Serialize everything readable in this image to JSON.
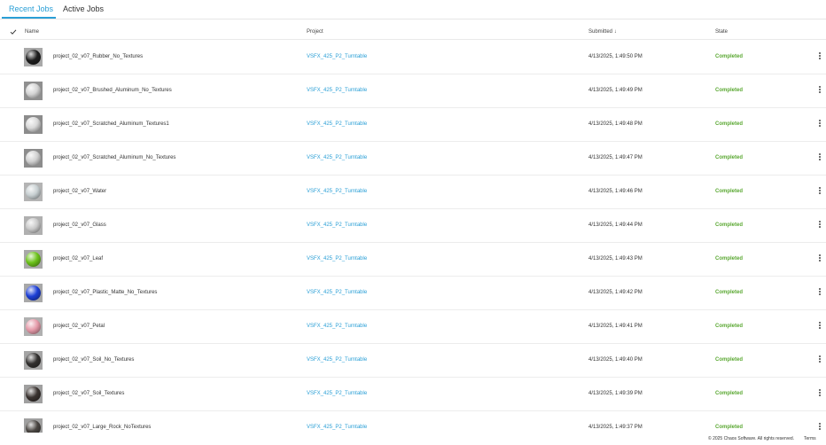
{
  "tabs": {
    "recent": "Recent Jobs",
    "active": "Active Jobs"
  },
  "columns": {
    "name": "Name",
    "project": "Project",
    "submitted": "Submitted",
    "sort_icon": "↓",
    "state": "State"
  },
  "rows": [
    {
      "name": "project_02_v07_Rubber_No_Textures",
      "project": "VSFX_425_P2_Turntable",
      "submitted": "4/13/2025, 1:49:50 PM",
      "state": "Completed",
      "thumb_color": "#1e1e1e",
      "thumb_bg": "#a9a9a9"
    },
    {
      "name": "project_02_v07_Brushed_Aluminum_No_Textures",
      "project": "VSFX_425_P2_Turntable",
      "submitted": "4/13/2025, 1:49:49 PM",
      "state": "Completed",
      "thumb_color": "#d4d4d4",
      "thumb_bg": "#8f8f8f"
    },
    {
      "name": "project_02_v07_Scratched_Aluminum_Textures1",
      "project": "VSFX_425_P2_Turntable",
      "submitted": "4/13/2025, 1:49:48 PM",
      "state": "Completed",
      "thumb_color": "#d8d8d8",
      "thumb_bg": "#8c8c8c"
    },
    {
      "name": "project_02_v07_Scratched_Aluminum_No_Textures",
      "project": "VSFX_425_P2_Turntable",
      "submitted": "4/13/2025, 1:49:47 PM",
      "state": "Completed",
      "thumb_color": "#d0d0d0",
      "thumb_bg": "#8c8c8c"
    },
    {
      "name": "project_02_v07_Water",
      "project": "VSFX_425_P2_Turntable",
      "submitted": "4/13/2025, 1:49:46 PM",
      "state": "Completed",
      "thumb_color": "#c7cfd1",
      "thumb_bg": "#b4b4b4"
    },
    {
      "name": "project_02_v07_Glass",
      "project": "VSFX_425_P2_Turntable",
      "submitted": "4/13/2025, 1:49:44 PM",
      "state": "Completed",
      "thumb_color": "#c9c9c9",
      "thumb_bg": "#b0b0b0"
    },
    {
      "name": "project_02_v07_Leaf",
      "project": "VSFX_425_P2_Turntable",
      "submitted": "4/13/2025, 1:49:43 PM",
      "state": "Completed",
      "thumb_color": "#6cc21b",
      "thumb_bg": "#a8a8a8"
    },
    {
      "name": "project_02_v07_Plastic_Matte_No_Textures",
      "project": "VSFX_425_P2_Turntable",
      "submitted": "4/13/2025, 1:49:42 PM",
      "state": "Completed",
      "thumb_color": "#1d3fd6",
      "thumb_bg": "#a8a8a8"
    },
    {
      "name": "project_02_v07_Petal",
      "project": "VSFX_425_P2_Turntable",
      "submitted": "4/13/2025, 1:49:41 PM",
      "state": "Completed",
      "thumb_color": "#e59aa9",
      "thumb_bg": "#b0b0b0"
    },
    {
      "name": "project_02_v07_Soil_No_Textures",
      "project": "VSFX_425_P2_Turntable",
      "submitted": "4/13/2025, 1:49:40 PM",
      "state": "Completed",
      "thumb_color": "#333130",
      "thumb_bg": "#a5a5a5"
    },
    {
      "name": "project_02_v07_Soil_Textures",
      "project": "VSFX_425_P2_Turntable",
      "submitted": "4/13/2025, 1:49:39 PM",
      "state": "Completed",
      "thumb_color": "#3a3330",
      "thumb_bg": "#a0a0a0"
    },
    {
      "name": "project_02_v07_Large_Rock_NoTextures",
      "project": "VSFX_425_P2_Turntable",
      "submitted": "4/13/2025, 1:49:37 PM",
      "state": "Completed",
      "thumb_color": "#4a4642",
      "thumb_bg": "#a0a0a0"
    }
  ],
  "footer": {
    "copyright": "© 2025 Chaos Software. All rights reserved.",
    "terms": "Terms"
  },
  "colors": {
    "accent": "#2a9fd6",
    "completed": "#5aa832"
  }
}
